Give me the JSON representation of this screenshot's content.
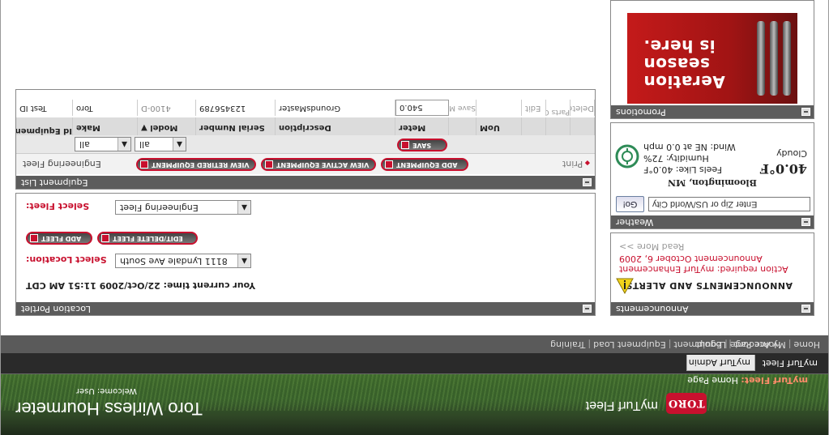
{
  "header": {
    "brand_product": "myTurf Fleet",
    "logo_text": "TORO",
    "crumb_prefix": "myTurf Fleet:",
    "crumb_page": "Home Page",
    "app_title": "Toro Wirless Hourmeter",
    "welcome": "Welcome: User"
  },
  "tabs": [
    "myTurf Fleet",
    "myTurf Admin"
  ],
  "nav": {
    "left": [
      "Home Page",
      "Equipment",
      "Equipment Load",
      "Training"
    ],
    "right": [
      "Home",
      "My Account",
      "Logout"
    ]
  },
  "announcements": {
    "title": "Announcements",
    "heading": "ANNOUNCEMENTS AND ALERTS",
    "line1": "Action required: myTurf Enhancement",
    "line2": "Announcement October 6, 2009",
    "read_more": "Read More >>"
  },
  "weather": {
    "title": "Weather",
    "input_placeholder": "Enter Zip or US/World City",
    "go_label": "Go!",
    "city": "Bloomington, MN",
    "temp": "40.0°F",
    "feels": "Feels Like: 40.0°F",
    "humidity": "Humidity: 72%",
    "wind": "Wind: NE at 0.0 mph",
    "condition": "Cloudy"
  },
  "promotions": {
    "title": "Promotions",
    "promo_line1": "Aeration",
    "promo_line2": "season",
    "promo_line3": "is here."
  },
  "location": {
    "title": "Location Portlet",
    "time_label": "Your current time: 22/Oct/2009 11:51 AM CDT",
    "select_location_label": "Select Location:",
    "location_value": "8111 Lyndale Ave South",
    "select_fleet_label": "Select Fleet:",
    "fleet_value": "Engineering Fleet",
    "add_fleet": "ADD FLEET",
    "edit_fleet": "EDIT/DELETE FLEET"
  },
  "equipment": {
    "title": "Equipment List",
    "fleet_name": "Engineering Fleet",
    "view_retired": "VIEW RETIRED EQUIPMENT",
    "view_active": "VIEW ACTIVE EQUIPMENT",
    "add_equipment": "ADD EQUIPMENT",
    "print": "Print",
    "save": "SAVE",
    "filter_make": "all",
    "filter_model": "all",
    "columns": [
      "Id Equipment",
      "Make",
      "Model ▼",
      "Serial Number",
      "Description",
      "Meter",
      "",
      "UoM",
      "",
      "",
      ""
    ],
    "row": {
      "id": "Test ID",
      "make": "Toro",
      "model": "4100-D",
      "serial": "123456789",
      "description": "GroundsMaster",
      "meter": "540.0",
      "save_miles": "Save Miles",
      "edit": "Edit",
      "parts_order": "Parts Order",
      "delete": "Delete"
    }
  }
}
